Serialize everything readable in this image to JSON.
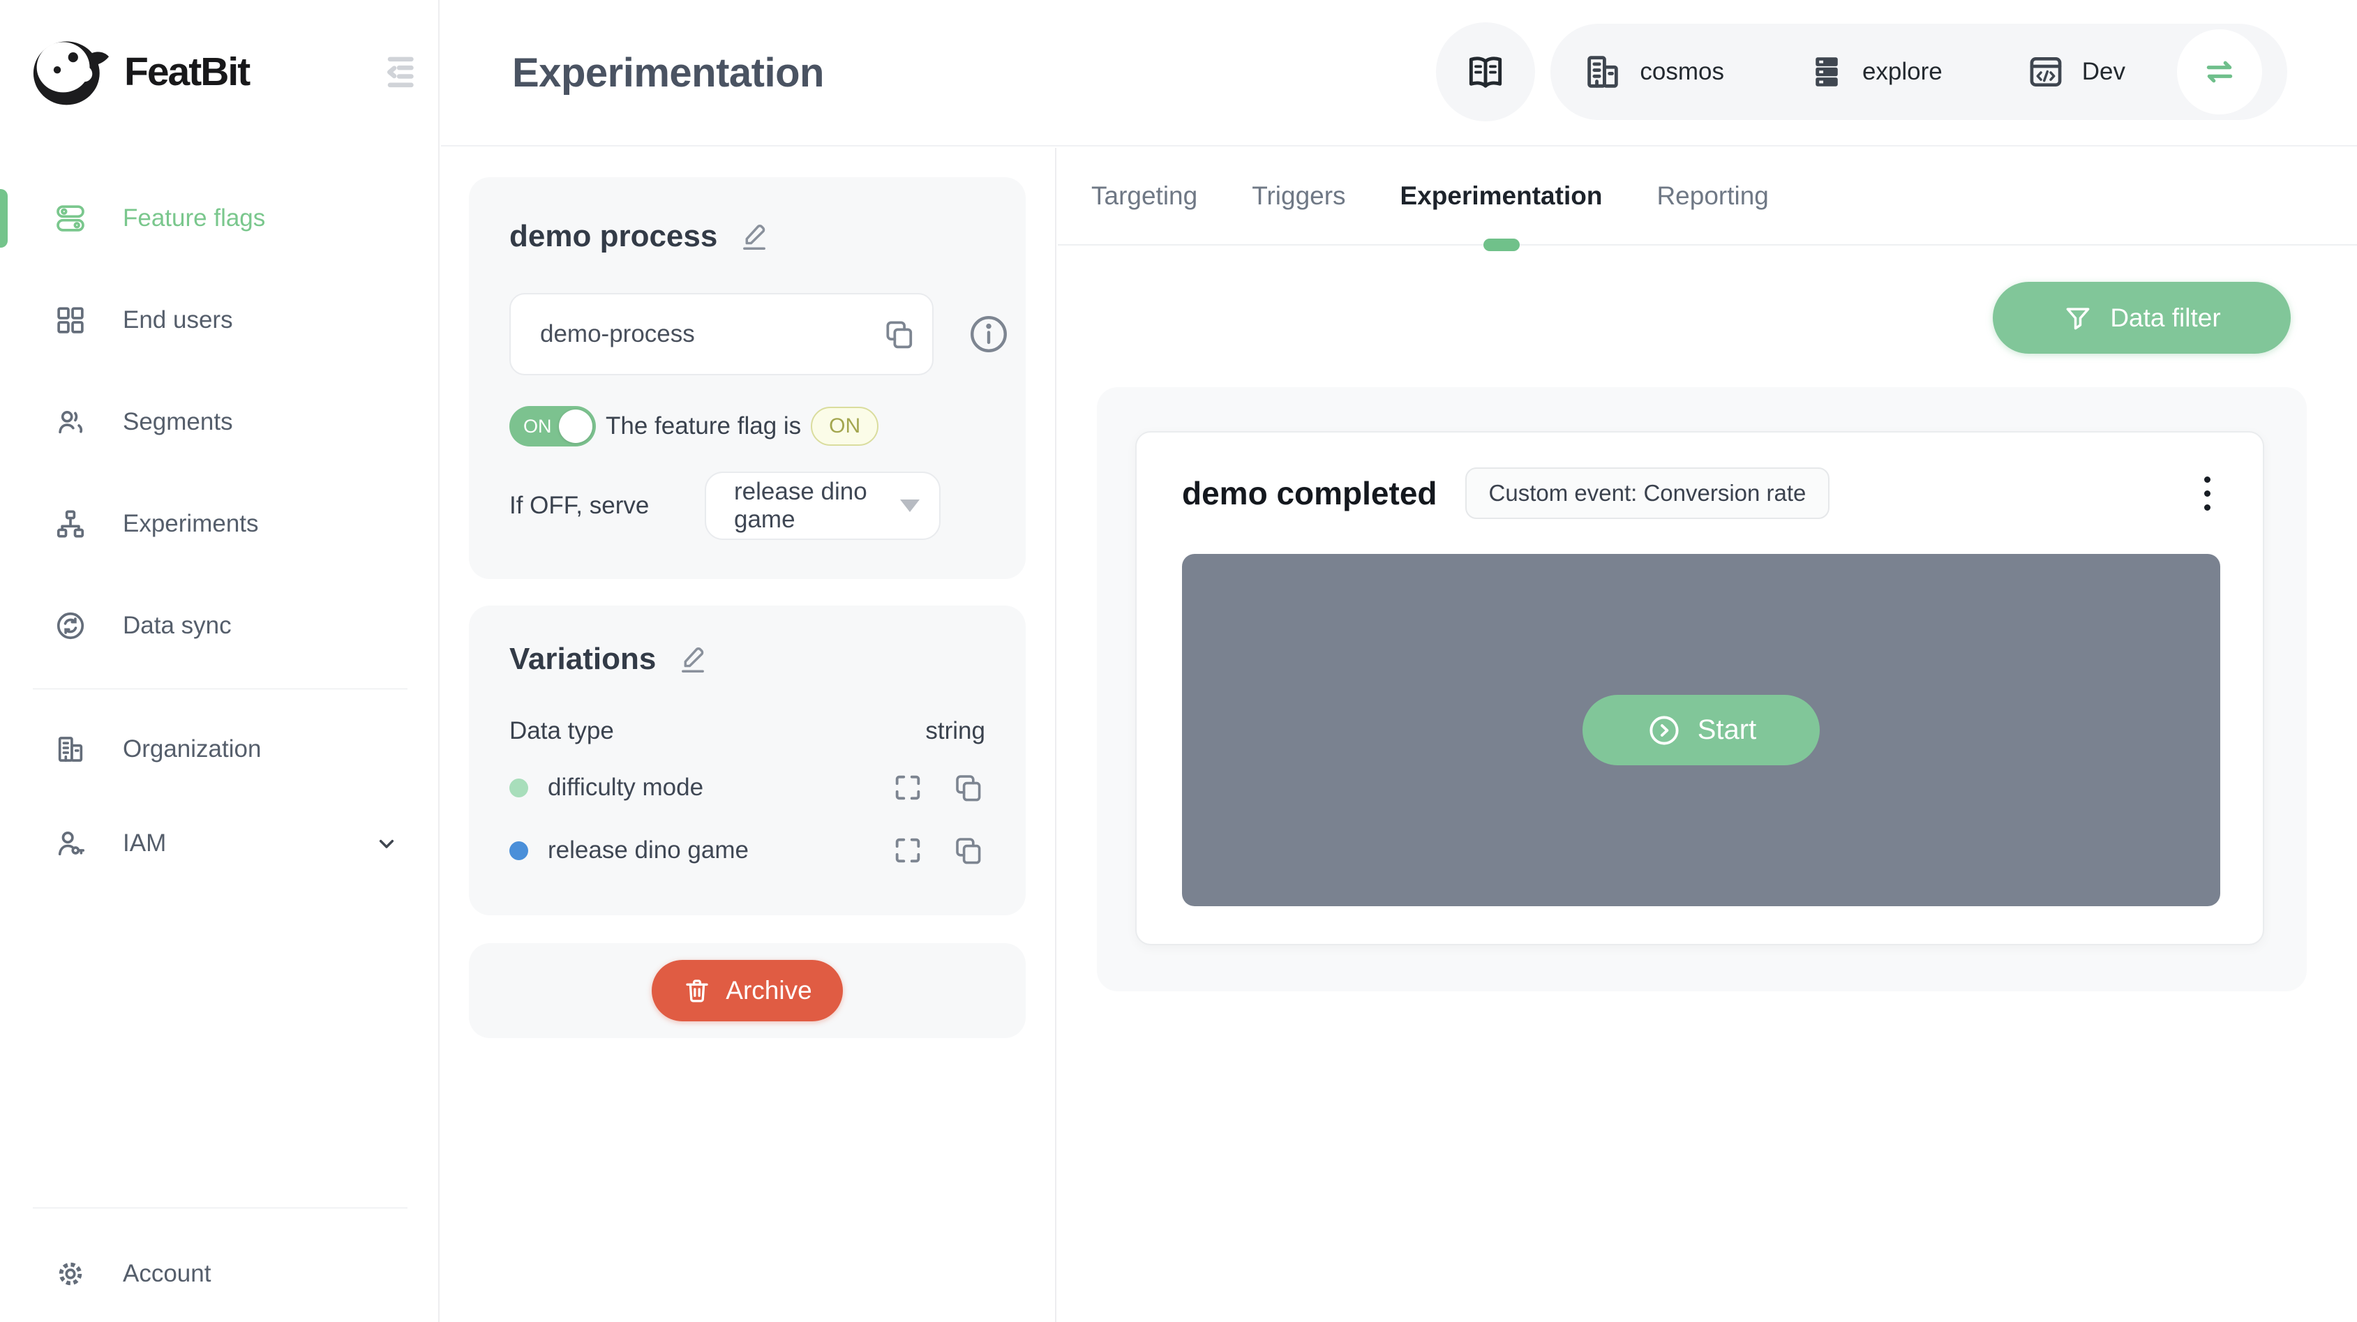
{
  "brand": {
    "name": "FeatBit"
  },
  "sidebar": {
    "items": [
      {
        "label": "Feature flags",
        "icon": "feature-flags-icon",
        "active": true
      },
      {
        "label": "End users",
        "icon": "end-users-icon",
        "active": false
      },
      {
        "label": "Segments",
        "icon": "segments-icon",
        "active": false
      },
      {
        "label": "Experiments",
        "icon": "experiments-icon",
        "active": false
      },
      {
        "label": "Data sync",
        "icon": "data-sync-icon",
        "active": false
      }
    ],
    "secondary_items": [
      {
        "label": "Organization",
        "icon": "organization-icon"
      },
      {
        "label": "IAM",
        "icon": "iam-icon"
      }
    ],
    "footer_items": [
      {
        "label": "Account",
        "icon": "gear-icon"
      }
    ]
  },
  "header": {
    "title": "Experimentation",
    "project": "cosmos",
    "workspace": "explore",
    "environment": "Dev"
  },
  "tabs": {
    "active_tab": "Experimentation",
    "items": [
      {
        "label": "Targeting"
      },
      {
        "label": "Triggers"
      },
      {
        "label": "Experimentation"
      },
      {
        "label": "Reporting"
      }
    ]
  },
  "flag": {
    "name": "demo process",
    "key": "demo-process",
    "toggle_state": "ON",
    "status_prefix": "The feature flag is",
    "status_value": "ON",
    "off_serve_label": "If OFF, serve",
    "off_serve_value": "release dino game"
  },
  "variations": {
    "title": "Variations",
    "data_type_label": "Data type",
    "data_type_value": "string",
    "items": [
      {
        "name": "difficulty mode",
        "color": "#a8debb"
      },
      {
        "name": "release dino game",
        "color": "#4a8fd9"
      }
    ]
  },
  "archive": {
    "label": "Archive"
  },
  "experimentation": {
    "filter_button_label": "Data filter",
    "card_title": "demo completed",
    "card_badge": "Custom event: Conversion rate",
    "start_button_label": "Start"
  },
  "colors": {
    "accent_green": "#7ac78d",
    "button_green": "#81c699",
    "toggle_green": "#7cc28f",
    "tab_indicator_green": "#70c18a",
    "archive_red": "#e05c43",
    "experiment_panel_gray": "#7a8290",
    "on_badge_bg": "#fbfce8",
    "on_badge_border": "#dadd9e",
    "on_badge_text": "#a3a64f",
    "variation_dot_difficulty": "#a8debb",
    "variation_dot_release": "#4a8fd9"
  }
}
